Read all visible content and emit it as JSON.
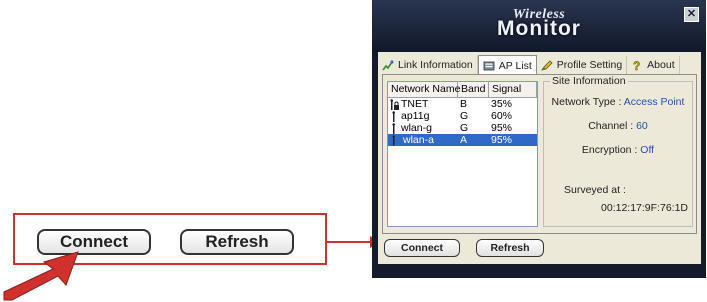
{
  "callout": {
    "connect_label": "Connect",
    "refresh_label": "Refresh"
  },
  "window": {
    "title_small": "Wireless",
    "title_big": "Monitor",
    "close_glyph": "✕",
    "tabs": [
      {
        "label": "Link Information",
        "icon": "link-info-icon"
      },
      {
        "label": "AP List",
        "icon": "ap-list-icon"
      },
      {
        "label": "Profile Setting",
        "icon": "profile-icon"
      },
      {
        "label": "About",
        "icon": "about-icon"
      }
    ],
    "list": {
      "headers": [
        "Network Name",
        "Band",
        "Signal"
      ],
      "rows": [
        {
          "name": "TNET",
          "band": "B",
          "signal": "35%",
          "locked": true
        },
        {
          "name": "ap11g",
          "band": "G",
          "signal": "60%",
          "locked": false
        },
        {
          "name": "wlan-g",
          "band": "G",
          "signal": "95%",
          "locked": false
        },
        {
          "name": "wlan-a",
          "band": "A",
          "signal": "95%",
          "locked": false
        }
      ],
      "selected_index": 3
    },
    "site_info": {
      "legend": "Site Information",
      "network_type_label": "Network Type :",
      "network_type_value": "Access Point",
      "channel_label": "Channel :",
      "channel_value": "60",
      "encryption_label": "Encryption :",
      "encryption_value": "Off",
      "surveyed_label": "Surveyed at :",
      "surveyed_value": "00:12:17:9F:76:1D"
    },
    "buttons": {
      "connect": "Connect",
      "refresh": "Refresh"
    }
  },
  "colors": {
    "accent_red": "#d0312d",
    "selection_blue": "#3169c6",
    "window_dark": "#141c2c"
  }
}
